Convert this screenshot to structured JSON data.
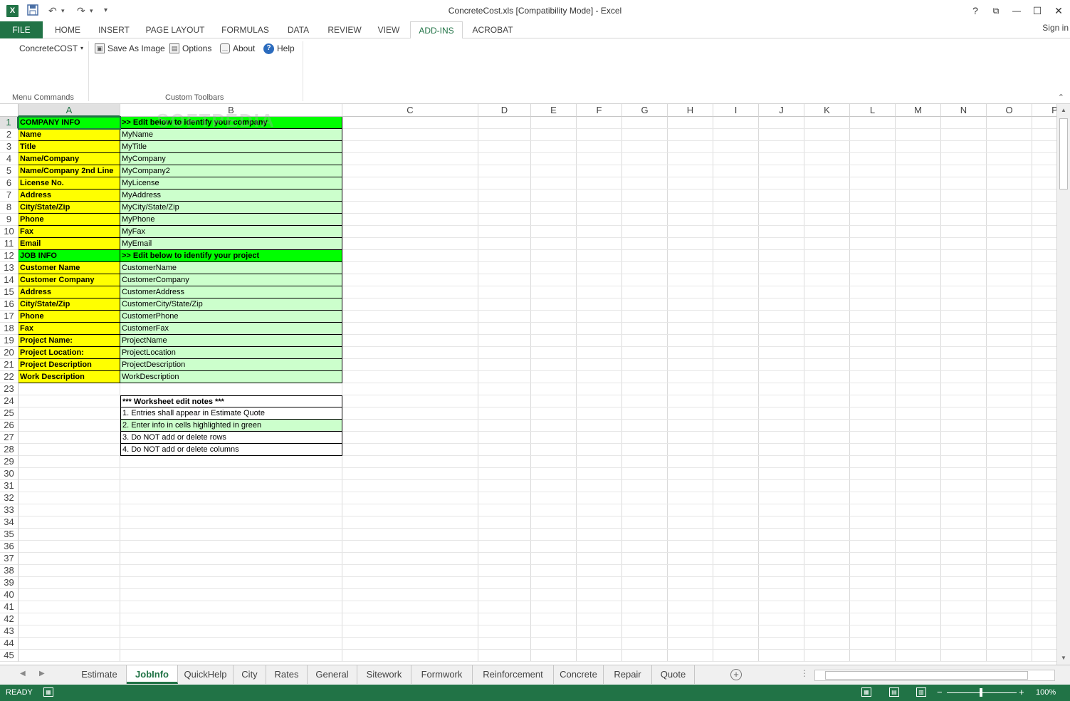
{
  "titlebar": {
    "app_icon": "X",
    "title": "ConcreteCost.xls  [Compatibility Mode] - Excel",
    "undo_icon": "↶",
    "redo_icon": "↷",
    "help_glyph": "?",
    "restore_glyph": "⧉",
    "minimize_glyph": "—",
    "maximize_glyph": "☐",
    "close_glyph": "✕"
  },
  "ribbon_tabs": [
    "HOME",
    "INSERT",
    "PAGE LAYOUT",
    "FORMULAS",
    "DATA",
    "REVIEW",
    "VIEW",
    "ADD-INS",
    "ACROBAT"
  ],
  "file_tab": "FILE",
  "active_tab": "ADD-INS",
  "signin": "Sign in",
  "ribbon": {
    "menu_command": "ConcreteCOST",
    "save_as_image": "Save As Image",
    "options": "Options",
    "about": "About",
    "help": "Help",
    "group_menu_commands": "Menu Commands",
    "group_custom_toolbars": "Custom Toolbars"
  },
  "grid": {
    "columns": [
      "A",
      "B",
      "C",
      "D",
      "E",
      "F",
      "G",
      "H",
      "I",
      "J",
      "K",
      "L",
      "M",
      "N",
      "O",
      "P"
    ],
    "row_count": 45,
    "selected_column": "A",
    "selected_row": 1,
    "rows": [
      {
        "a": "COMPANY INFO",
        "b": ">> Edit below to identify your company",
        "style": "header"
      },
      {
        "a": "Name",
        "b": "MyName"
      },
      {
        "a": "Title",
        "b": "MyTitle"
      },
      {
        "a": "Name/Company",
        "b": "MyCompany"
      },
      {
        "a": "Name/Company 2nd Line",
        "b": "MyCompany2"
      },
      {
        "a": "License No.",
        "b": "MyLicense"
      },
      {
        "a": "Address",
        "b": "MyAddress"
      },
      {
        "a": "City/State/Zip",
        "b": "MyCity/State/Zip"
      },
      {
        "a": "Phone",
        "b": "MyPhone"
      },
      {
        "a": "Fax",
        "b": "MyFax"
      },
      {
        "a": "Email",
        "b": "MyEmail"
      },
      {
        "a": "JOB INFO",
        "b": ">> Edit below to identify your project",
        "style": "header"
      },
      {
        "a": "Customer Name",
        "b": "CustomerName"
      },
      {
        "a": "Customer Company",
        "b": "CustomerCompany"
      },
      {
        "a": "Address",
        "b": "CustomerAddress"
      },
      {
        "a": "City/State/Zip",
        "b": "CustomerCity/State/Zip"
      },
      {
        "a": "Phone",
        "b": "CustomerPhone"
      },
      {
        "a": "Fax",
        "b": "CustomerFax"
      },
      {
        "a": "Project Name:",
        "b": "ProjectName"
      },
      {
        "a": "Project Location:",
        "b": "ProjectLocation"
      },
      {
        "a": "Project Description",
        "b": "ProjectDescription"
      },
      {
        "a": "Work Description",
        "b": "WorkDescription"
      }
    ],
    "notes_title": "*** Worksheet edit notes ***",
    "notes": [
      {
        "text": "1. Entries shall appear in Estimate Quote",
        "green": false
      },
      {
        "text": "2. Enter info in cells highlighted in green",
        "green": true
      },
      {
        "text": "3. Do NOT add or delete rows",
        "green": false
      },
      {
        "text": "4. Do NOT add or delete columns",
        "green": false
      }
    ],
    "watermark": "SOFTPEDIA"
  },
  "sheets": [
    "Estimate",
    "JobInfo",
    "QuickHelp",
    "City",
    "Rates",
    "General",
    "Sitework",
    "Formwork",
    "Reinforcement",
    "Concrete",
    "Repair",
    "Quote"
  ],
  "active_sheet": "JobInfo",
  "status": {
    "ready": "READY",
    "zoom": "100%",
    "zoom_level_percent": 100
  },
  "colors": {
    "excel_green": "#217346",
    "yellow_cell": "#ffff00",
    "header_green": "#00ff00",
    "light_green": "#ccffcc"
  }
}
